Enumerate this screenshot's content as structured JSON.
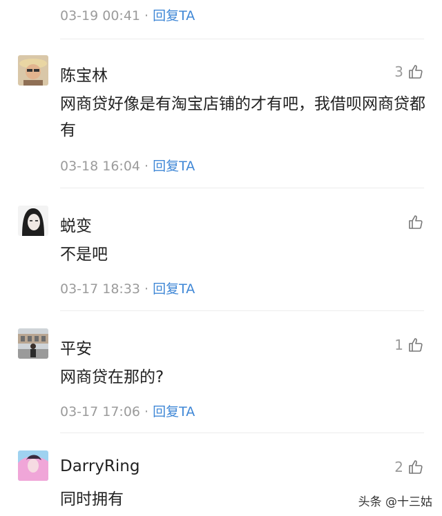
{
  "top": {
    "time": "03-19 00:41",
    "reply": "回复TA"
  },
  "comments": [
    {
      "name": "陈宝林",
      "likes": "3",
      "text": "网商贷好像是有淘宝店铺的才有吧，我借呗网商贷都有",
      "time": "03-18 16:04",
      "reply": "回复TA"
    },
    {
      "name": "蜕变",
      "likes": "",
      "text": "不是吧",
      "time": "03-17 18:33",
      "reply": "回复TA"
    },
    {
      "name": "平安",
      "likes": "1",
      "text": "网商贷在那的?",
      "time": "03-17 17:06",
      "reply": "回复TA"
    },
    {
      "name": "DarryRing",
      "likes": "2",
      "text": "同时拥有"
    }
  ],
  "like_icon": "thumbs-up-outline-icon",
  "watermark": "头条 @十三姑"
}
